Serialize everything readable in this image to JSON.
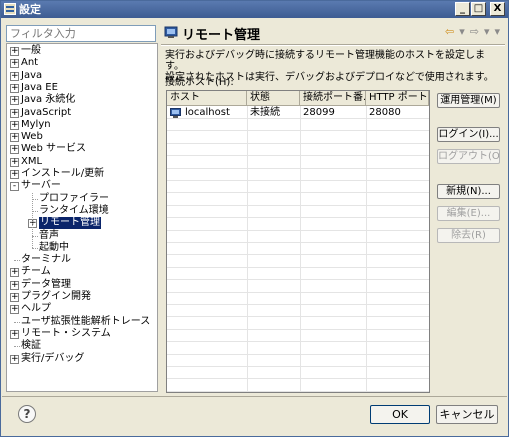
{
  "window": {
    "title": "設定",
    "controls": [
      "_",
      "□",
      "X"
    ]
  },
  "left": {
    "filter_placeholder": "フィルタ入力",
    "tree": [
      {
        "label": "一般",
        "expander": "+"
      },
      {
        "label": "Ant",
        "expander": "+"
      },
      {
        "label": "Java",
        "expander": "+"
      },
      {
        "label": "Java EE",
        "expander": "+"
      },
      {
        "label": "Java 永続化",
        "expander": "+"
      },
      {
        "label": "JavaScript",
        "expander": "+"
      },
      {
        "label": "Mylyn",
        "expander": "+"
      },
      {
        "label": "Web",
        "expander": "+"
      },
      {
        "label": "Web サービス",
        "expander": "+"
      },
      {
        "label": "XML",
        "expander": "+"
      },
      {
        "label": "インストール/更新",
        "expander": "+"
      },
      {
        "label": "サーバー",
        "expander": "-"
      },
      {
        "label": "プロファイラー",
        "expander": ""
      },
      {
        "label": "ランタイム環境",
        "expander": ""
      },
      {
        "label": "リモート管理",
        "expander": "+"
      },
      {
        "label": "音声",
        "expander": ""
      },
      {
        "label": "起動中",
        "expander": ""
      },
      {
        "label": "ターミナル",
        "expander": ""
      },
      {
        "label": "チーム",
        "expander": "+"
      },
      {
        "label": "データ管理",
        "expander": "+"
      },
      {
        "label": "プラグイン開発",
        "expander": "+"
      },
      {
        "label": "ヘルプ",
        "expander": "+"
      },
      {
        "label": "ユーザ拡張性能解析トレース",
        "expander": ""
      },
      {
        "label": "リモート・システム",
        "expander": "+"
      },
      {
        "label": "検証",
        "expander": ""
      },
      {
        "label": "実行/デバッグ",
        "expander": "+"
      }
    ]
  },
  "page": {
    "title": "リモート管理",
    "nav": {
      "back": "⇦",
      "back_menu": "▾",
      "forward": "⇨",
      "forward_menu": "▾",
      "menu": "▾"
    },
    "description_line1": "実行およびデバッグ時に接続するリモート管理機能のホストを設定します。",
    "description_line2": "設定されたホストは実行、デバッグおよびデプロイなどで使用されます。",
    "list_label": "接続ホスト(H):",
    "table": {
      "headers": [
        "ホスト",
        "状態",
        "接続ポート番...",
        "HTTP ポート..."
      ],
      "rows": [
        {
          "host": "localhost",
          "status": "未接続",
          "port": "28099",
          "http_port": "28080"
        }
      ]
    },
    "buttons": {
      "manage": "運用管理(M)",
      "login": "ログイン(I)...",
      "logout": "ログアウト(O)",
      "new": "新規(N)...",
      "edit": "編集(E)...",
      "remove": "除去(R)"
    }
  },
  "footer": {
    "help": "?",
    "ok": "OK",
    "cancel": "キャンセル"
  },
  "colors": {
    "titlebar": "#3d5c92",
    "selection": "#0a246a"
  }
}
